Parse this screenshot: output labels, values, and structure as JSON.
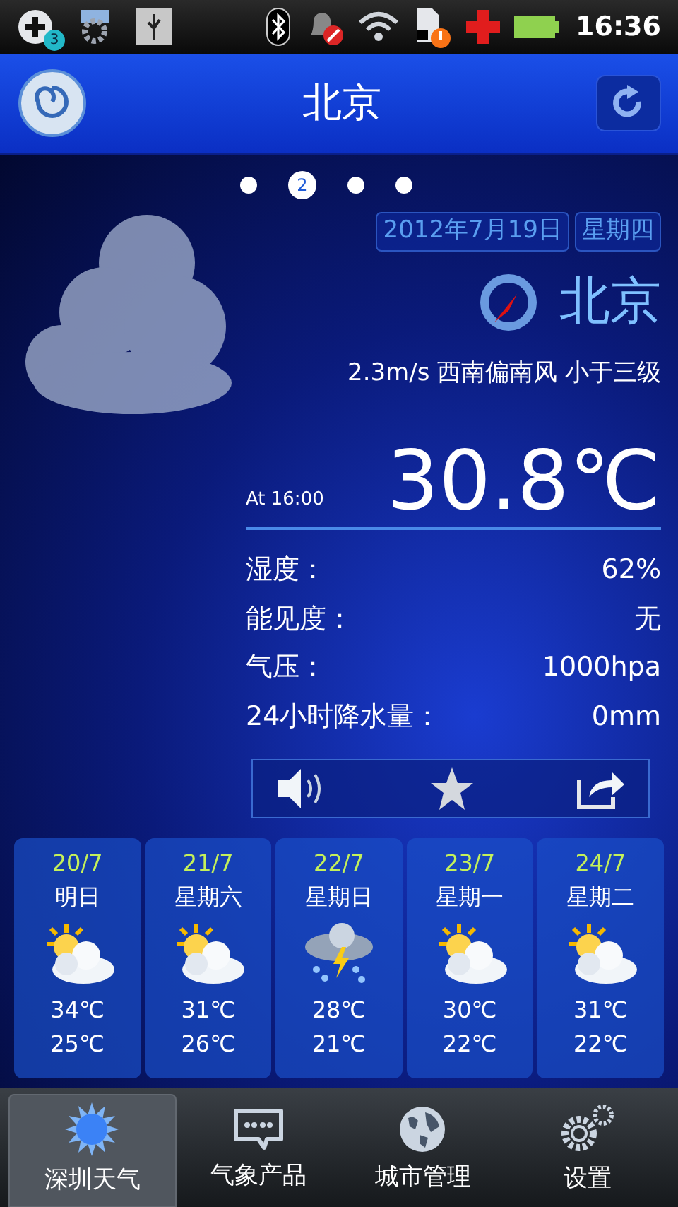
{
  "status_bar": {
    "notification_count": "3",
    "time": "16:36"
  },
  "header": {
    "title": "北京"
  },
  "page_dots": [
    {
      "selected": false
    },
    {
      "selected": true,
      "label": "2"
    },
    {
      "selected": false
    },
    {
      "selected": false
    }
  ],
  "current": {
    "date": "2012年7月19日",
    "weekday": "星期四",
    "city": "北京",
    "wind": "2.3m/s 西南偏南风 小于三级",
    "time": "At 16:00",
    "temperature": "30.8℃",
    "details": [
      {
        "label": "湿度：",
        "value": "62%"
      },
      {
        "label": "能见度：",
        "value": "无"
      },
      {
        "label": "气压：",
        "value": "1000hpa"
      },
      {
        "label": "24小时降水量：",
        "value": "0mm"
      }
    ]
  },
  "forecast": [
    {
      "date": "20/7",
      "day": "明日",
      "kind": "partly_cloudy",
      "high": "34℃",
      "low": "25℃"
    },
    {
      "date": "21/7",
      "day": "星期六",
      "kind": "partly_cloudy",
      "high": "31℃",
      "low": "26℃"
    },
    {
      "date": "22/7",
      "day": "星期日",
      "kind": "thunderstorm",
      "high": "28℃",
      "low": "21℃"
    },
    {
      "date": "23/7",
      "day": "星期一",
      "kind": "partly_cloudy",
      "high": "30℃",
      "low": "22℃"
    },
    {
      "date": "24/7",
      "day": "星期二",
      "kind": "partly_cloudy",
      "high": "31℃",
      "low": "22℃"
    }
  ],
  "tab_bar": [
    {
      "label": "深圳天气",
      "kind": "sun",
      "selected": true
    },
    {
      "label": "气象产品",
      "kind": "chat",
      "selected": false
    },
    {
      "label": "城市管理",
      "kind": "globe",
      "selected": false
    },
    {
      "label": "设置",
      "kind": "gears",
      "selected": false
    }
  ]
}
